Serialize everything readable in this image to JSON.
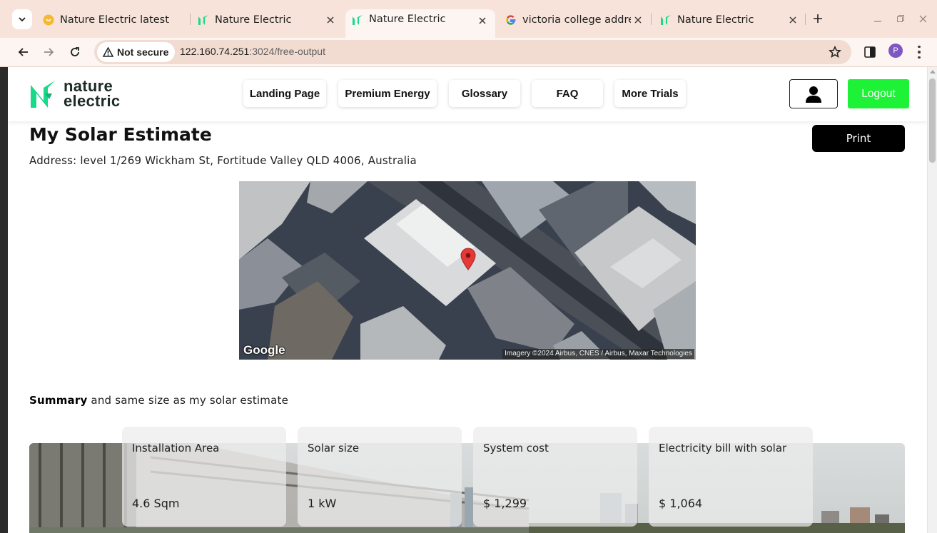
{
  "browser": {
    "tabs": [
      {
        "title": "Nature Electric latest",
        "favicon": "yellow-circle-icon",
        "active": false
      },
      {
        "title": "Nature Electric",
        "favicon": "nature-electric-icon",
        "active": false
      },
      {
        "title": "Nature Electric",
        "favicon": "nature-electric-icon",
        "active": true
      },
      {
        "title": "victoria college addre",
        "favicon": "google-g-icon",
        "active": false
      },
      {
        "title": "Nature Electric",
        "favicon": "nature-electric-icon",
        "active": false
      }
    ],
    "security_label": "Not secure",
    "url_host": "122.160.74.251",
    "url_rest": ":3024/free-output",
    "profile_initial": "P"
  },
  "header": {
    "logo_line1": "nature",
    "logo_line2": "electric",
    "nav": [
      "Landing Page",
      "Premium Energy",
      "Glossary",
      "FAQ",
      "More Trials"
    ],
    "logout_label": "Logout"
  },
  "page": {
    "title": "My Solar Estimate",
    "address": "Address: level 1/269 Wickham St, Fortitude Valley QLD 4006, Australia",
    "print_label": "Print",
    "map": {
      "logo": "Google",
      "attribution": "Imagery ©2024 Airbus, CNES / Airbus, Maxar Technologies"
    },
    "summary_bold": "Summary",
    "summary_rest": " and same size as my solar estimate",
    "cards": [
      {
        "label": "Installation Area",
        "value": "4.6 Sqm"
      },
      {
        "label": "Solar size",
        "value": "1 kW"
      },
      {
        "label": "System cost",
        "value": "$ 1,299"
      },
      {
        "label": "Electricity bill with solar",
        "value": "$ 1,064"
      }
    ]
  },
  "colors": {
    "brand_green": "#1ef237",
    "logo_green": "#16d98a",
    "tab_strip": "#f7e3d9"
  }
}
